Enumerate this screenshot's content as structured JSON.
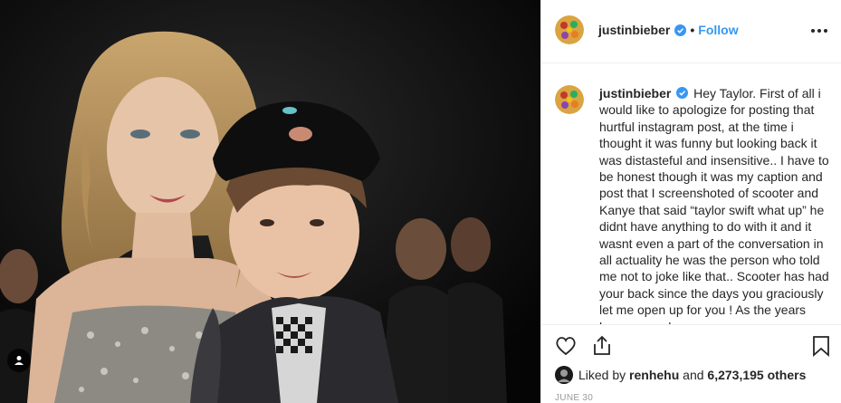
{
  "post": {
    "username": "justinbieber",
    "follow_label": "Follow",
    "dot": "•",
    "caption": "Hey Taylor. First of all i would like to apologize for posting that hurtful instagram post, at the time i thought it was funny but looking back it was distasteful and insensitive.. I have to be honest though it was my caption and post that I screenshoted of scooter and Kanye that said “taylor swift what up” he didnt have anything to do with it and it wasnt even a part of the conversation in all actuality he was the person who told me not to joke like that.. Scooter has had your back since the days you graciously let me open up for you ! As the years have passed we",
    "liked_by_prefix": "Liked by ",
    "liked_by_user": "renhehu",
    "liked_by_and": " and ",
    "liked_by_count": "6,273,195 others",
    "date": "JUNE 30"
  },
  "icons": {
    "more": "more-options-icon",
    "heart": "heart-icon",
    "share": "share-icon",
    "bookmark": "bookmark-icon",
    "verified": "verified-badge-icon",
    "user_tag": "user-tag-icon"
  },
  "colors": {
    "accent": "#3897f0",
    "text": "#262626",
    "muted": "#999999",
    "border": "#efefef"
  }
}
